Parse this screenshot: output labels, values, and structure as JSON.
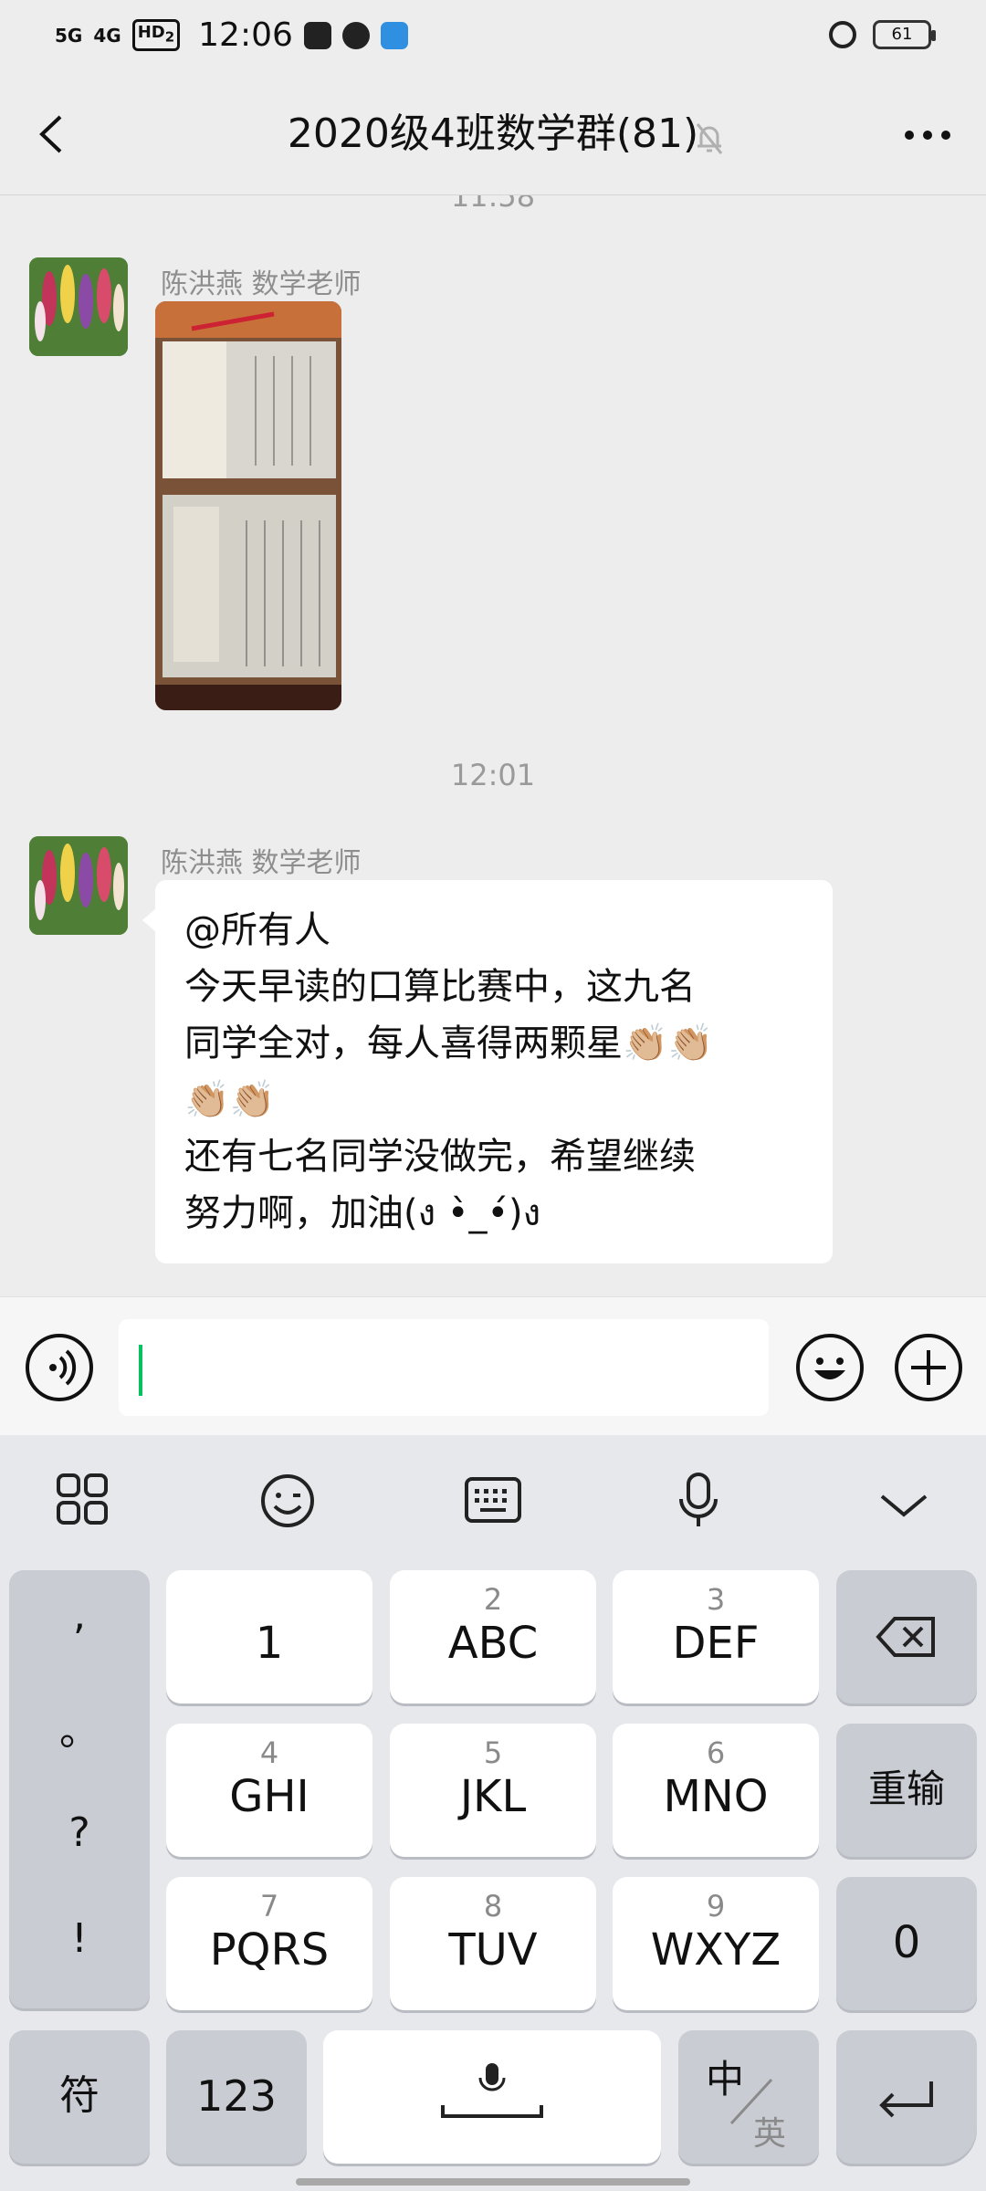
{
  "status_bar": {
    "signal_5g": "5G",
    "signal_4g": "4G",
    "hd_badge": "HD",
    "hd_sub": "2",
    "time": "12:06",
    "battery": "61"
  },
  "nav": {
    "title": "2020级4班数学群(81)"
  },
  "chat": {
    "timestamp_top": "11:58",
    "message1": {
      "sender": "陈洪燕  数学老师"
    },
    "timestamp_mid": "12:01",
    "message2": {
      "sender": "陈洪燕  数学老师",
      "text": "@所有人\n今天早读的口算比赛中，这九名\n同学全对，每人喜得两颗星👏🏼👏🏼\n👏🏼👏🏼\n还有七名同学没做完，希望继续\n努力啊，加油(ง •̀_•́)ง"
    }
  },
  "input": {
    "value": ""
  },
  "keyboard": {
    "punct": [
      ",",
      "。",
      "?",
      "!"
    ],
    "keys": [
      {
        "sub": "",
        "main": "1"
      },
      {
        "sub": "2",
        "main": "ABC"
      },
      {
        "sub": "3",
        "main": "DEF"
      },
      {
        "sub": "4",
        "main": "GHI"
      },
      {
        "sub": "5",
        "main": "JKL"
      },
      {
        "sub": "6",
        "main": "MNO"
      },
      {
        "sub": "7",
        "main": "PQRS"
      },
      {
        "sub": "8",
        "main": "TUV"
      },
      {
        "sub": "9",
        "main": "WXYZ"
      }
    ],
    "retype": "重输",
    "zero": "0",
    "symbol": "符",
    "num": "123",
    "lang_cn": "中",
    "lang_en": "英"
  }
}
